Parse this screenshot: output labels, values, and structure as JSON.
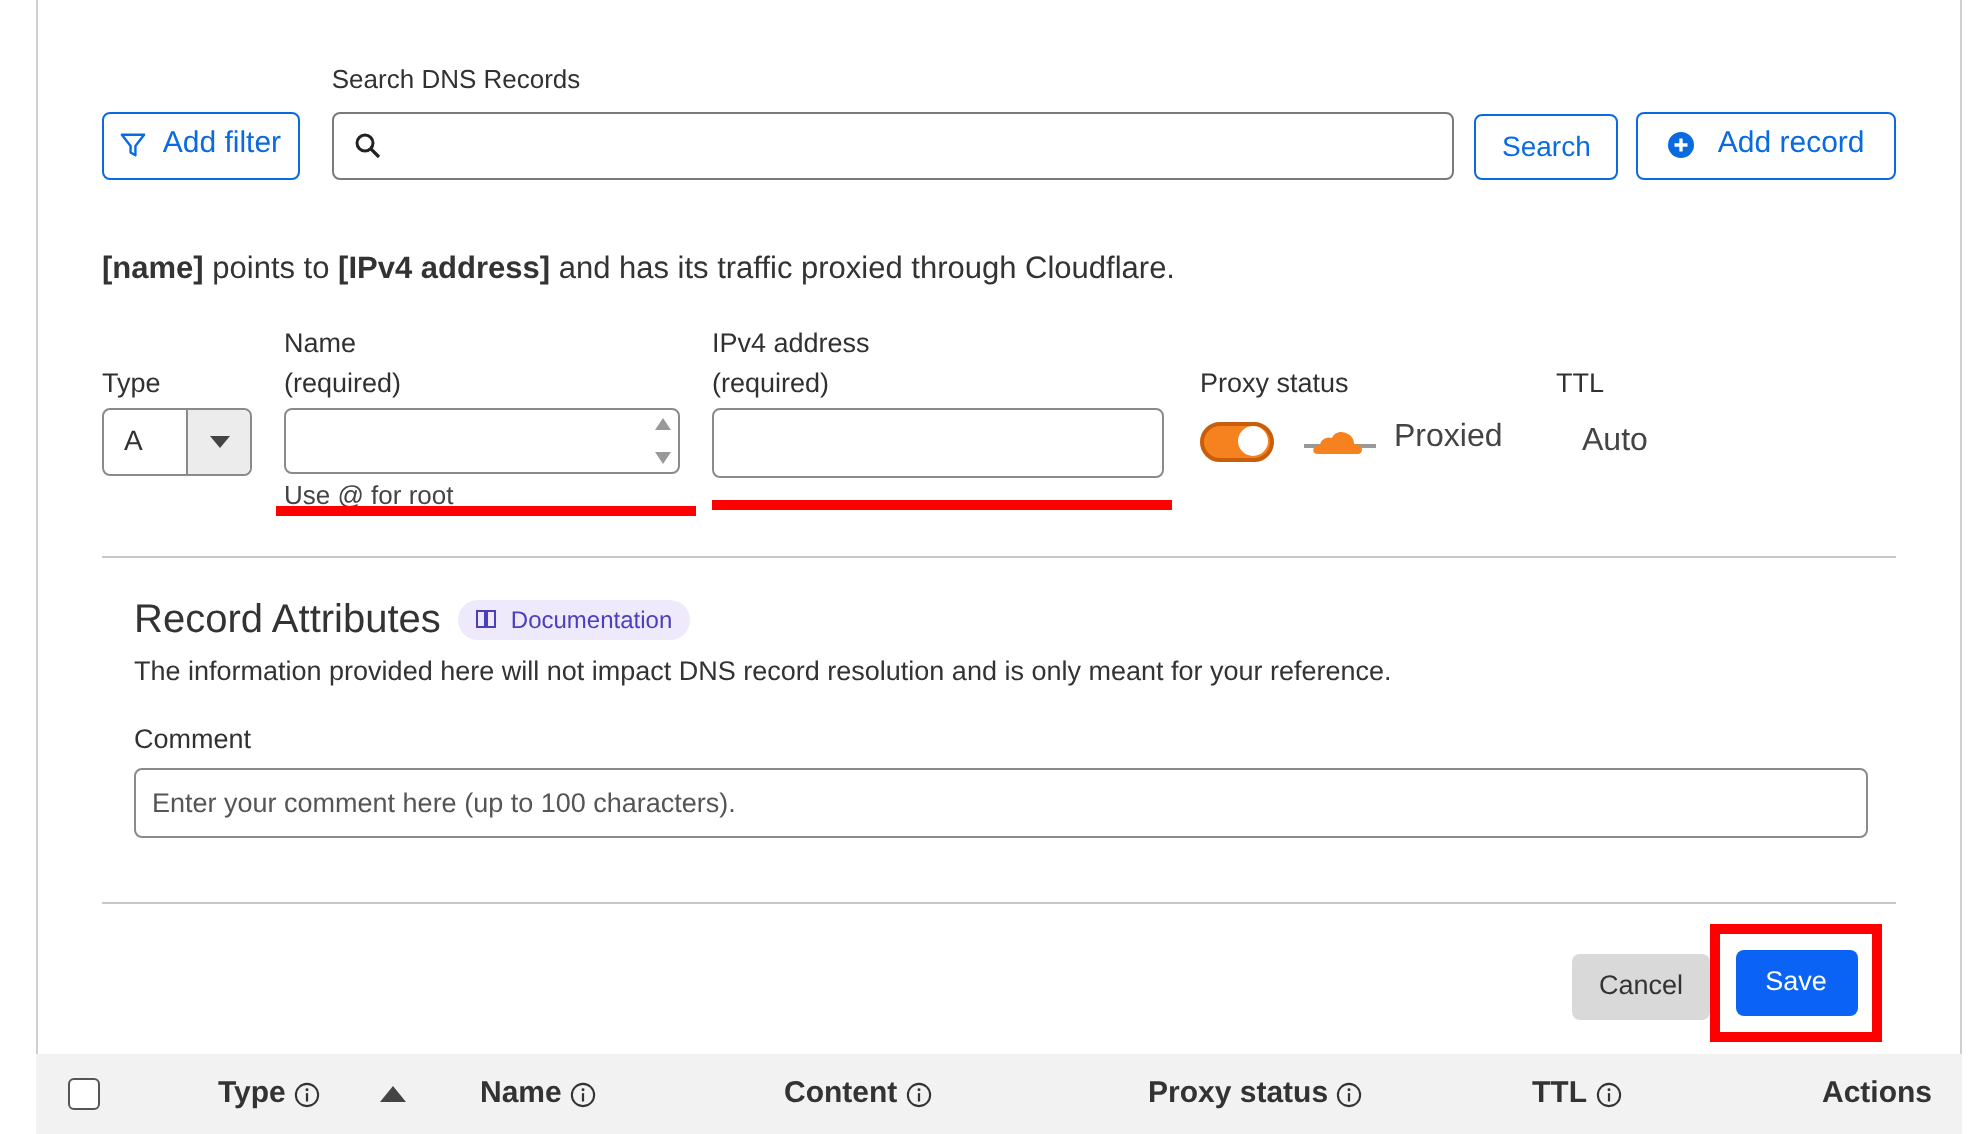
{
  "search_bar": {
    "add_filter": "Add filter",
    "search_label": "Search DNS Records",
    "search_button": "Search",
    "add_record": "Add record"
  },
  "description": "**[name]** points to **[IPv4 address]** and has its traffic proxied through Cloudflare.",
  "form": {
    "type": {
      "label": "Type",
      "value": "A"
    },
    "name": {
      "label": "Name",
      "required": "(required)",
      "helper": "Use @ for root",
      "annotated": true
    },
    "ipv4": {
      "label": "IPv4 address",
      "required": "(required)",
      "annotated": true
    },
    "proxy": {
      "label": "Proxy status",
      "on": true,
      "text": "Proxied"
    },
    "ttl": {
      "label": "TTL",
      "value": "Auto"
    }
  },
  "record_attributes": {
    "title": "Record Attributes",
    "badge": "Documentation",
    "description": "The information provided here will not impact DNS record resolution and is only meant for your reference.",
    "comment_label": "Comment",
    "comment_placeholder": "Enter your comment here (up to 100 characters)."
  },
  "actions": {
    "cancel": "Cancel",
    "save": "Save",
    "save_annotated": true
  },
  "table": {
    "select_all_checked": false,
    "columns": [
      {
        "label": "Type",
        "info": true,
        "sorted": true
      },
      {
        "label": "Name",
        "info": true,
        "sorted": false
      },
      {
        "label": "Content",
        "info": true,
        "sorted": false
      },
      {
        "label": "Proxy status",
        "info": true,
        "sorted": false
      },
      {
        "label": "TTL",
        "info": true,
        "sorted": false
      },
      {
        "label": "Actions",
        "info": false,
        "sorted": false
      }
    ]
  }
}
